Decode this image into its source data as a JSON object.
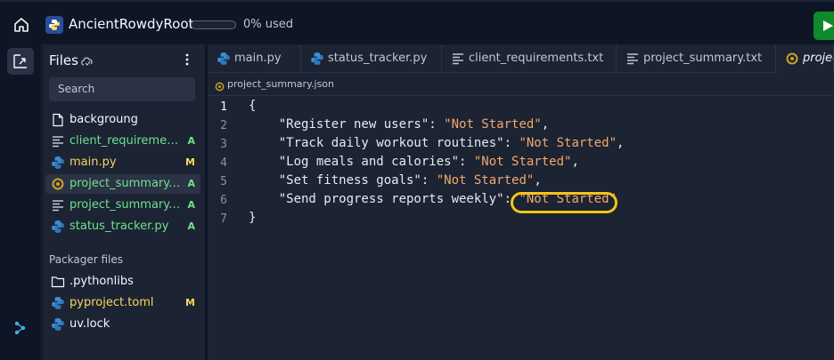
{
  "header": {
    "app_title": "AncientRowdyRoot",
    "usage_label": "0% used",
    "usage_fraction": 0
  },
  "files_panel": {
    "title": "Files",
    "search_placeholder": "Search",
    "items": [
      {
        "name": "backgroung",
        "icon": "file-icon",
        "status": "",
        "color": "white"
      },
      {
        "name": "client_requirements.txt",
        "icon": "text-file-icon",
        "status": "A",
        "color": "green"
      },
      {
        "name": "main.py",
        "icon": "python-icon",
        "status": "M",
        "color": "yellow"
      },
      {
        "name": "project_summary.json",
        "icon": "json-icon",
        "status": "A",
        "color": "green"
      },
      {
        "name": "project_summary.txt",
        "icon": "text-file-icon",
        "status": "A",
        "color": "green"
      },
      {
        "name": "status_tracker.py",
        "icon": "python-icon",
        "status": "A",
        "color": "green"
      }
    ],
    "packager_title": "Packager files",
    "packager_items": [
      {
        "name": ".pythonlibs",
        "icon": "folder-icon",
        "status": "",
        "color": "white"
      },
      {
        "name": "pyproject.toml",
        "icon": "python-icon",
        "status": "M",
        "color": "yellow"
      },
      {
        "name": "uv.lock",
        "icon": "python-icon",
        "status": "",
        "color": "white"
      }
    ]
  },
  "tabs": [
    {
      "label": "main.py",
      "icon": "python-icon"
    },
    {
      "label": "status_tracker.py",
      "icon": "python-icon"
    },
    {
      "label": "client_requirements.txt",
      "icon": "text-file-icon"
    },
    {
      "label": "project_summary.txt",
      "icon": "text-file-icon"
    },
    {
      "label": "project_summary.json",
      "icon": "json-icon",
      "active": true
    }
  ],
  "breadcrumb": "project_summary.json",
  "code": {
    "current_line": 1,
    "line_numbers": [
      "1",
      "2",
      "3",
      "4",
      "5",
      "6",
      "7"
    ],
    "open_brace": "{",
    "close_brace": "}",
    "entries": [
      {
        "key": "\"Register new users\"",
        "value": "\"Not Started\"",
        "sep": ": ",
        "end": ","
      },
      {
        "key": "\"Track daily workout routines\"",
        "value": "\"Not Started\"",
        "sep": ": ",
        "end": ","
      },
      {
        "key": "\"Log meals and calories\"",
        "value": "\"Not Started\"",
        "sep": ": ",
        "end": ","
      },
      {
        "key": "\"Set fitness goals\"",
        "value": "\"Not Started\"",
        "sep": ": ",
        "end": ","
      },
      {
        "key": "\"Send progress reports weekly\"",
        "value": "\"Not Started\"",
        "sep": ": ",
        "end": ""
      }
    ]
  },
  "colors": {
    "background": "#0e1525",
    "panel": "#1c2333",
    "accent_green": "#6ee38e",
    "accent_yellow": "#f5d85c",
    "string_value": "#f2a869",
    "highlight_circle": "#f5c518",
    "run_button": "#0f8a2a"
  }
}
